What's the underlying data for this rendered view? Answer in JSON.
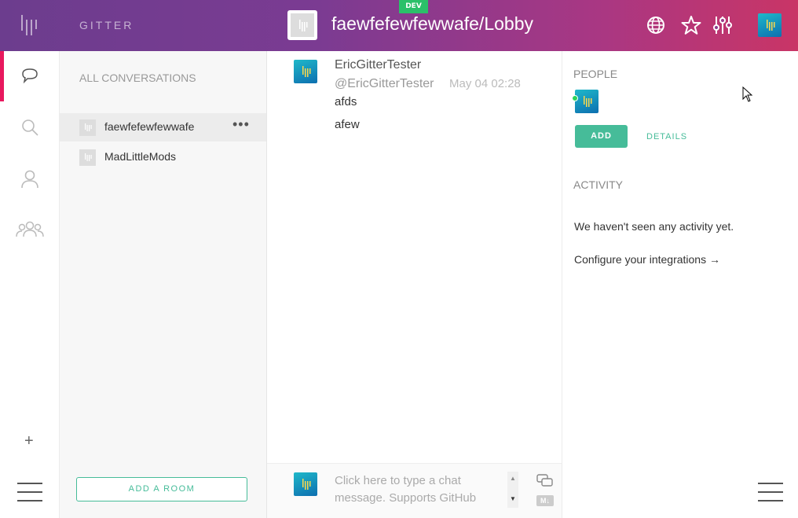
{
  "header": {
    "brand": "GITTER",
    "dev_badge": "DEV",
    "room_title": "faewfefewfewwafe/Lobby"
  },
  "rail": {
    "add_label": "+"
  },
  "conversations": {
    "title": "ALL CONVERSATIONS",
    "items": [
      {
        "label": "faewfefewfewwafe",
        "active": true
      },
      {
        "label": "MadLittleMods",
        "active": false
      }
    ],
    "menu_label": "•••",
    "add_room_label": "ADD A ROOM"
  },
  "chat": {
    "message": {
      "name": "EricGitterTester",
      "handle": "@EricGitterTester",
      "time": "May 04 02:28",
      "lines": [
        "afds",
        "afew"
      ]
    },
    "input_placeholder": "Click here to type a chat message. Supports GitHub",
    "md_label": "M↓"
  },
  "right_panel": {
    "people_title": "PEOPLE",
    "add_label": "ADD",
    "details_label": "DETAILS",
    "activity_title": "ACTIVITY",
    "activity_empty": "We haven't seen any activity yet.",
    "configure_link": "Configure your integrations →"
  },
  "colors": {
    "accent_green": "#46bc99",
    "active_rail": "#e8185e",
    "header_start": "#6c3d8e",
    "header_end": "#c93566"
  }
}
